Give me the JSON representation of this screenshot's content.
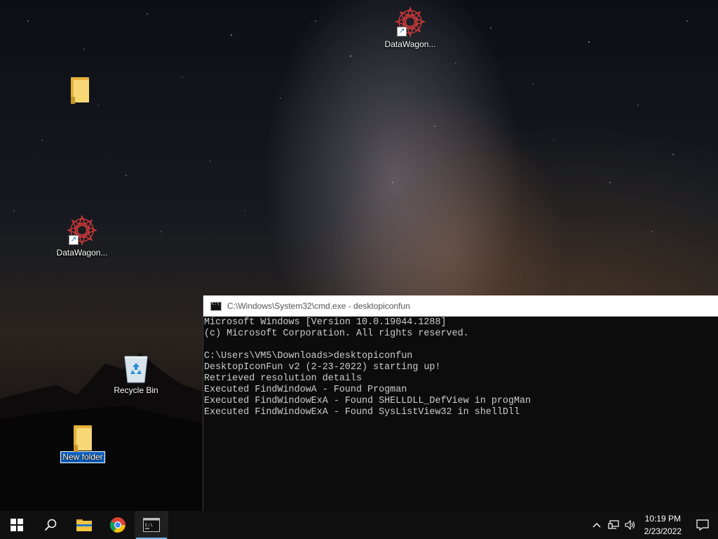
{
  "desktop": {
    "icons": [
      {
        "label": "DataWagon...",
        "type": "shortcut"
      },
      {
        "label": "",
        "type": "folder"
      },
      {
        "label": "DataWagon...",
        "type": "shortcut"
      },
      {
        "label": "Recycle Bin",
        "type": "recycle-bin"
      },
      {
        "label": "New folder",
        "type": "folder",
        "state": "renaming"
      }
    ]
  },
  "cmd_window": {
    "title": "C:\\Windows\\System32\\cmd.exe - desktopiconfun",
    "lines": [
      "Microsoft Windows [Version 10.0.19044.1288]",
      "(c) Microsoft Corporation. All rights reserved.",
      "",
      "C:\\Users\\VM5\\Downloads>desktopiconfun",
      "DesktopIconFun v2 (2-23-2022) starting up!",
      "Retrieved resolution details",
      "Executed FindWindowA - Found Progman",
      "Executed FindWindowExA - Found SHELLDLL_DefView in progMan",
      "Executed FindWindowExA - Found SysListView32 in shellDll"
    ]
  },
  "taskbar": {
    "buttons": [
      "windows-start-icon",
      "search-icon",
      "file-explorer-icon",
      "chrome-icon",
      "command-prompt-icon"
    ],
    "active": "command-prompt-icon",
    "tray": {
      "icons": [
        "chevron-up-icon",
        "network-icon",
        "volume-icon"
      ],
      "time": "10:19 PM",
      "date": "2/23/2022"
    }
  },
  "colors": {
    "selection": "#0a64c8",
    "taskbar": "#101010",
    "console_bg": "#0c0c0c",
    "console_text": "#cccccc",
    "active_indicator": "#76b9ed"
  }
}
